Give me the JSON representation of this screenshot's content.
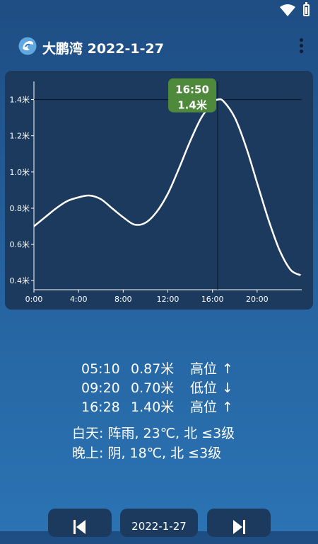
{
  "app": {
    "title": "大鹏湾 2022-1-27"
  },
  "chart_data": {
    "type": "line",
    "x_ticks": [
      "0:00",
      "4:00",
      "8:00",
      "12:00",
      "16:00",
      "20:00"
    ],
    "y_ticks": [
      "0.4米",
      "0.6米",
      "0.8米",
      "1.0米",
      "1.2米",
      "1.4米"
    ],
    "xlim_hours": [
      0,
      24
    ],
    "ylim": [
      0.35,
      1.5
    ],
    "series": [
      {
        "x": [
          0,
          1,
          2,
          3,
          4,
          5,
          6,
          7,
          8,
          9,
          10,
          11,
          12,
          13,
          14,
          15,
          16,
          16.467,
          17,
          18,
          19,
          20,
          21,
          22,
          23,
          23.9
        ],
        "y": [
          0.7,
          0.75,
          0.8,
          0.84,
          0.86,
          0.87,
          0.85,
          0.8,
          0.75,
          0.71,
          0.72,
          0.78,
          0.88,
          1.02,
          1.17,
          1.3,
          1.38,
          1.4,
          1.39,
          1.3,
          1.14,
          0.94,
          0.74,
          0.57,
          0.46,
          0.43
        ]
      }
    ],
    "crosshair": {
      "x": 16.467,
      "y": 1.4
    },
    "tooltip": {
      "time": "16:50",
      "height": "1.4米"
    },
    "grid": false
  },
  "tides": [
    {
      "time": "05:10",
      "height": "0.87米",
      "type": "高位",
      "arrow": "↑"
    },
    {
      "time": "09:20",
      "height": "0.70米",
      "type": "低位",
      "arrow": "↓"
    },
    {
      "time": "16:28",
      "height": "1.40米",
      "type": "高位",
      "arrow": "↑"
    }
  ],
  "weather": {
    "day": "白天: 阵雨, 23℃, 北 ≤3级",
    "night": "晚上: 阴, 18℃, 北 ≤3级"
  },
  "bottom": {
    "date": "2022-1-27"
  },
  "colors": {
    "tooltip_bg": "#4f8a3c",
    "card_bg": "#1b3a5d",
    "line": "#ffffff"
  }
}
